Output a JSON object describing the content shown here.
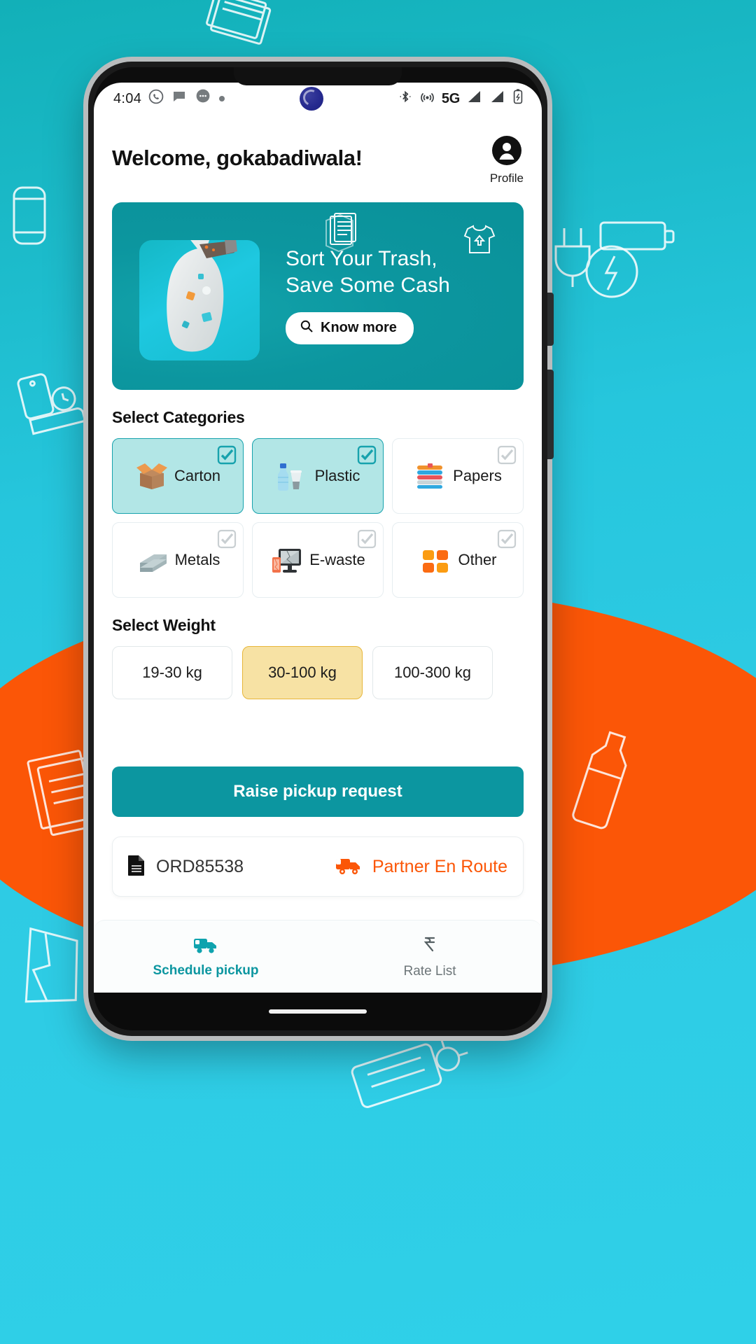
{
  "status_bar": {
    "time": "4:04",
    "network": "5G",
    "left_icons": [
      "whatsapp-icon",
      "chat-icon",
      "messages-icon",
      "dot-icon"
    ],
    "right_icons": [
      "bluetooth-icon",
      "hotspot-icon",
      "signal-icon",
      "signal-2-icon",
      "battery-icon"
    ],
    "center_icon": "camera-punch-hole"
  },
  "header": {
    "title": "Welcome, gokabadiwala!",
    "profile_label": "Profile",
    "profile_icon": "account-circle-icon"
  },
  "banner": {
    "line1": "Sort Your Trash,",
    "line2": "Save Some Cash",
    "cta_label": "Know more",
    "cta_icon": "search-icon",
    "image_alt": "hand-holding-plastic-waste-bag",
    "deco_icons": [
      "documents-stack-icon",
      "tshirt-icon"
    ],
    "bg_color": "#0c969f"
  },
  "categories": {
    "title": "Select Categories",
    "items": [
      {
        "label": "Carton",
        "icon": "carton-box-icon",
        "selected": true
      },
      {
        "label": "Plastic",
        "icon": "plastic-bottle-icon",
        "selected": true
      },
      {
        "label": "Papers",
        "icon": "paper-stack-icon",
        "selected": false
      },
      {
        "label": "Metals",
        "icon": "metal-sheets-icon",
        "selected": false
      },
      {
        "label": "E-waste",
        "icon": "broken-monitor-icon",
        "selected": false
      },
      {
        "label": "Other",
        "icon": "four-squares-icon",
        "selected": false
      }
    ],
    "selected_color": "#b2e6e6",
    "check_color": "#17a2ad"
  },
  "weight": {
    "title": "Select Weight",
    "options": [
      {
        "label": "19-30 kg",
        "selected": false
      },
      {
        "label": "30-100 kg",
        "selected": true
      },
      {
        "label": "100-300 kg",
        "selected": false
      }
    ],
    "selected_color": "#f7e2a4"
  },
  "primary_action": {
    "label": "Raise pickup request",
    "color": "#0c96a0"
  },
  "order": {
    "id": "ORD85538",
    "id_icon": "document-icon",
    "status": "Partner En Route",
    "status_icon": "delivery-truck-icon",
    "status_color": "#fb5607"
  },
  "bottom_nav": {
    "items": [
      {
        "label": "Schedule pickup",
        "icon": "truck-icon",
        "active": true
      },
      {
        "label": "Rate List",
        "icon": "rupee-icon",
        "active": false
      }
    ],
    "active_color": "#0c96a0"
  }
}
